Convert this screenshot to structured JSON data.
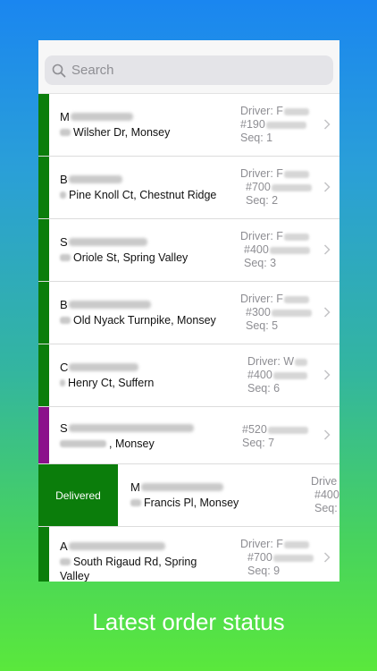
{
  "search": {
    "placeholder": "Search"
  },
  "colors": {
    "green": "#0b7d0b",
    "purple": "#8b118b"
  },
  "orders": [
    {
      "initial": "M",
      "address": "Wilsher Dr, Monsey",
      "driver": "Driver: F",
      "order": "#190",
      "seq": "Seq: 1",
      "status_color": "green"
    },
    {
      "initial": "B",
      "address": "Pine Knoll Ct, Chestnut Ridge",
      "driver": "Driver: F",
      "order": "#700",
      "seq": "Seq: 2",
      "status_color": "green"
    },
    {
      "initial": "S",
      "address": "Oriole St, Spring Valley",
      "driver": "Driver: F",
      "order": "#400",
      "seq": "Seq: 3",
      "status_color": "green"
    },
    {
      "initial": "B",
      "address": "Old Nyack Turnpike, Monsey",
      "driver": "Driver: F",
      "order": "#300",
      "seq": "Seq: 5",
      "status_color": "green"
    },
    {
      "initial": "C",
      "address": "Henry Ct, Suffern",
      "driver": "Driver: W",
      "order": "#400",
      "seq": "Seq: 6",
      "status_color": "green"
    },
    {
      "initial": "S",
      "address": ", Monsey",
      "driver": "",
      "order": "#520",
      "seq": "Seq: 7",
      "status_color": "purple"
    },
    {
      "initial": "M",
      "address": "Francis Pl, Monsey",
      "driver": "Drive",
      "order": "#400",
      "seq": "Seq:",
      "status_color": "green",
      "swipe_action": "Delivered"
    },
    {
      "initial": "A",
      "address": "South Rigaud Rd, Spring",
      "address_line2": "Valley",
      "driver": "Driver: F",
      "order": "#700",
      "seq": "Seq: 9",
      "status_color": "green"
    }
  ],
  "caption": "Latest order status"
}
